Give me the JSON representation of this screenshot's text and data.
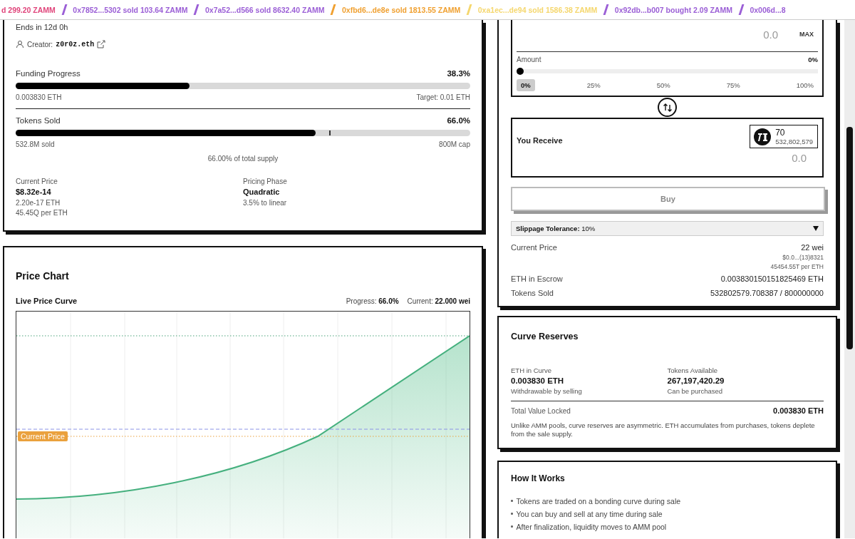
{
  "ticker": [
    {
      "text": "d 299.20 ZAMM",
      "color": "#e0457b"
    },
    {
      "text": "0x7852...5302 sold 103.64 ZAMM",
      "color": "#9b5fd6"
    },
    {
      "text": "0x7a52...d566 sold 8632.40 ZAMM",
      "color": "#9b5fd6"
    },
    {
      "text": "0xfbd6...de8e sold 1813.55 ZAMM",
      "color": "#f0a030"
    },
    {
      "text": "0xa1ec...de94 sold 1586.38 ZAMM",
      "color": "#f5d76e"
    },
    {
      "text": "0x92db...b007 bought 2.09 ZAMM",
      "color": "#9b5fd6"
    },
    {
      "text": "0x006d...8",
      "color": "#9b5fd6"
    }
  ],
  "sale_card": {
    "ends": "Ends in 12d 0h",
    "creator_label": "Creator:",
    "creator": "z0r0z.eth",
    "funding": {
      "label": "Funding Progress",
      "percent": "38.3%",
      "level": 0.383,
      "left_note": "0.003830 ETH",
      "right_note": "Target: 0.01 ETH"
    },
    "tokens_sold": {
      "label": "Tokens Sold",
      "percent": "66.0%",
      "level": 0.66,
      "marker": {
        "level": 0.69
      },
      "left_note": "532.8M sold",
      "right_note": "800M cap",
      "supply_note": "66.00% of total supply"
    },
    "stats": [
      {
        "label": "Current Price",
        "value": "$8.32e-14",
        "details": [
          "2.20e-17 ETH",
          "45.45Q per ETH"
        ]
      },
      {
        "label": "Pricing Phase",
        "value": "Quadratic",
        "details": [
          "3.5% to linear"
        ]
      }
    ]
  },
  "price_chart": {
    "title": "Price Chart",
    "subtitle": "Live Price Curve",
    "progress": "Progress: **66.0%**",
    "current": "Current: **22.000 wei**",
    "current_price_tag": "Current Price"
  },
  "trade": {
    "pay_amount": "0.0",
    "max": "MAX",
    "amount_label": "Amount",
    "amount_percent": "0%",
    "amount_slider": {
      "level": 0
    },
    "presets": [
      {
        "label": "0%",
        "selected": true
      },
      {
        "label": "25%",
        "selected": false
      },
      {
        "label": "50%",
        "selected": false
      },
      {
        "label": "75%",
        "selected": false
      },
      {
        "label": "100%",
        "selected": false
      }
    ],
    "receive": {
      "label": "You Receive",
      "token_symbol": "70",
      "token_balance": "532,802,579",
      "amount": "0.0"
    },
    "buy": {
      "label": "Buy",
      "disabled": true
    },
    "slippage": "**Slippage Tolerance:** 10%",
    "stats": [
      {
        "label": "Current Price",
        "value": "22 wei",
        "details": [
          "$0.0...(13)8321",
          "45454.55T per ETH"
        ]
      },
      {
        "label": "ETH in Escrow",
        "value": "0.003830150151825469 ETH"
      },
      {
        "label": "Tokens Sold",
        "value": "532802579.708387 / 800000000"
      }
    ]
  },
  "curve_reserves": {
    "title": "Curve Reserves",
    "items": [
      {
        "label": "ETH in Curve",
        "value": "0.003830 ETH",
        "note": "Withdrawable by selling"
      },
      {
        "label": "Tokens Available",
        "value": "267,197,420.29",
        "note": "Can be purchased"
      }
    ],
    "tvl_label": "Total Value Locked",
    "tvl": "0.003830 ETH",
    "note": "Unlike AMM pools, curve reserves are asymmetric. ETH accumulates from purchases, tokens deplete from the sale supply."
  },
  "how_it_works": {
    "title": "How It Works",
    "bullets": [
      "Tokens are traded on a bonding curve during sale",
      "You can buy and sell at any time during sale",
      "After finalization, liquidity moves to AMM pool"
    ]
  }
}
